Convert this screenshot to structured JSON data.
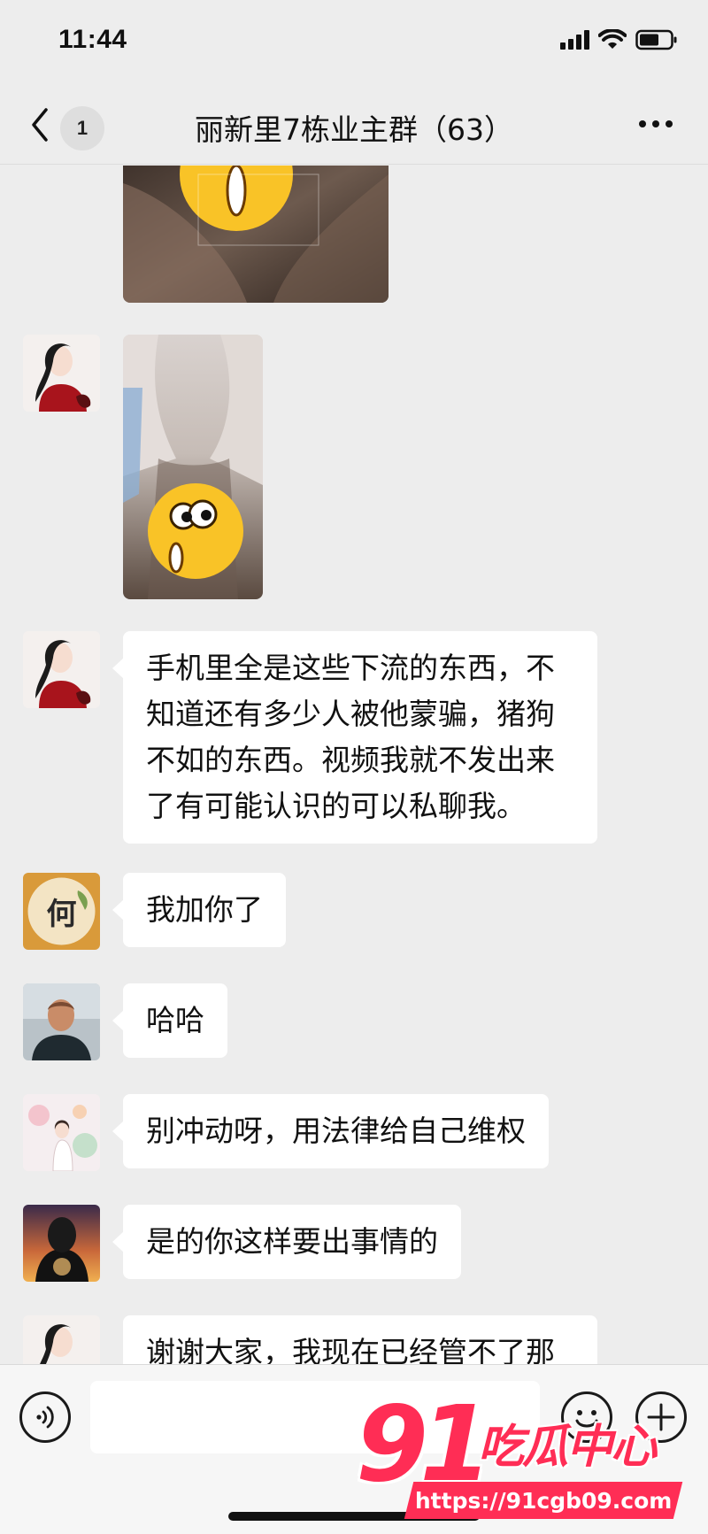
{
  "status_bar": {
    "time": "11:44"
  },
  "nav": {
    "unread_count": "1",
    "title": "丽新里7栋业主群（63）"
  },
  "messages": [
    {
      "type": "image",
      "content": "censored-photo-1"
    },
    {
      "type": "image",
      "content": "censored-photo-2"
    },
    {
      "type": "text",
      "text": "手机里全是这些下流的东西，不知道还有多少人被他蒙骗，猪狗不如的东西。视频我就不发出来了有可能认识的可以私聊我。"
    },
    {
      "type": "text",
      "text": "我加你了"
    },
    {
      "type": "text",
      "text": "哈哈"
    },
    {
      "type": "text",
      "text": "别冲动呀，用法律给自己维权"
    },
    {
      "type": "text",
      "text": "是的你这样要出事情的"
    },
    {
      "type": "text",
      "text": "谢谢大家，我现在已经管不了那"
    }
  ],
  "avatar_badge": "何",
  "input": {
    "placeholder": ""
  },
  "watermark": {
    "number": "91",
    "name": "吃瓜中心",
    "url": "https://91cgb09.com"
  },
  "colors": {
    "background": "#ededed",
    "bubble": "#ffffff",
    "watermark": "#ff2d55"
  }
}
